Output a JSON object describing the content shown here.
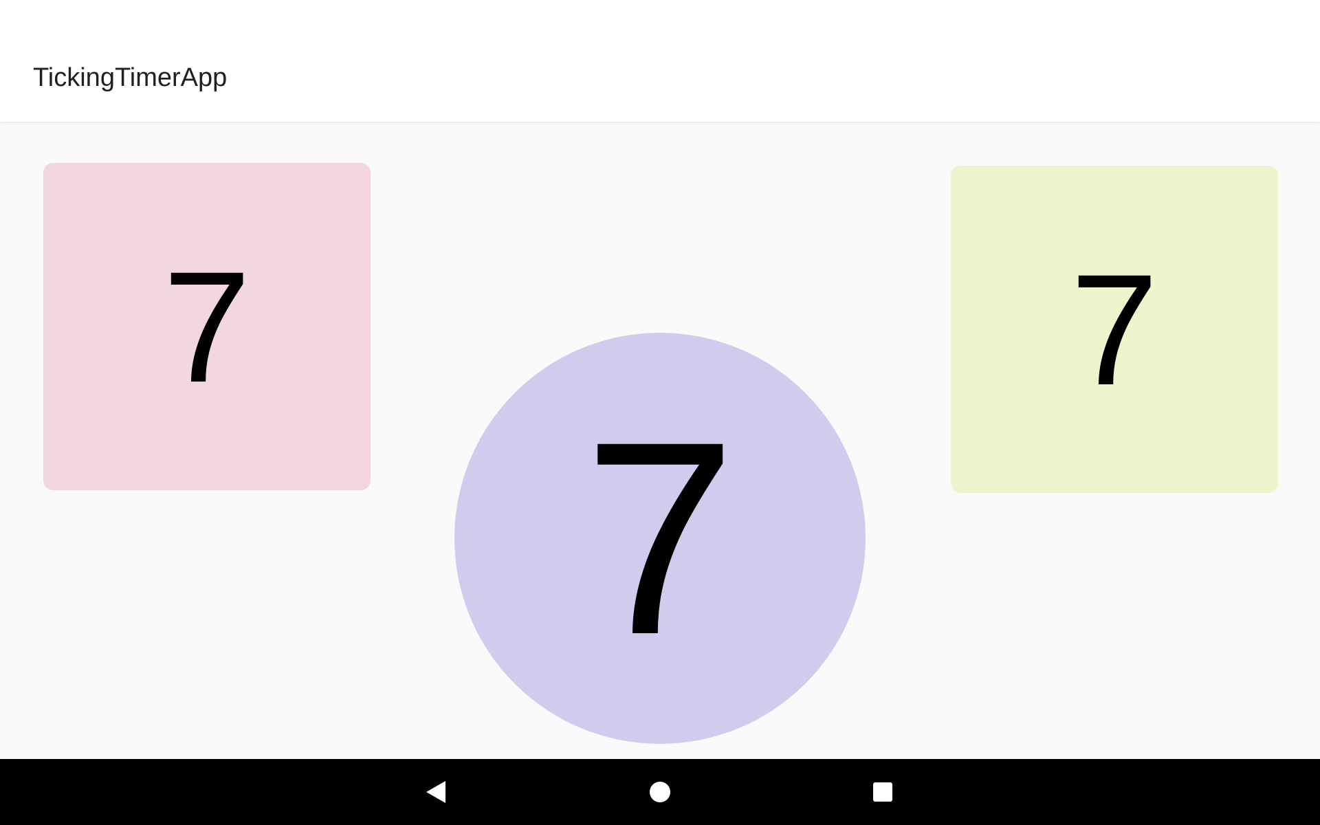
{
  "app": {
    "title": "TickingTimerApp"
  },
  "tiles": [
    {
      "name": "left-square",
      "value": "7",
      "color": "#f3d7df"
    },
    {
      "name": "center-circle",
      "value": "7",
      "color": "#d0ccee"
    },
    {
      "name": "right-square",
      "value": "7",
      "color": "#eff4cc"
    }
  ],
  "navigation": {
    "back_icon": "back-triangle-icon",
    "home_icon": "home-circle-icon",
    "recents_icon": "recents-square-icon"
  },
  "colors": {
    "background": "#fafafa",
    "app_bar": "#ffffff",
    "nav_bar": "#000000",
    "text": "#000000"
  }
}
